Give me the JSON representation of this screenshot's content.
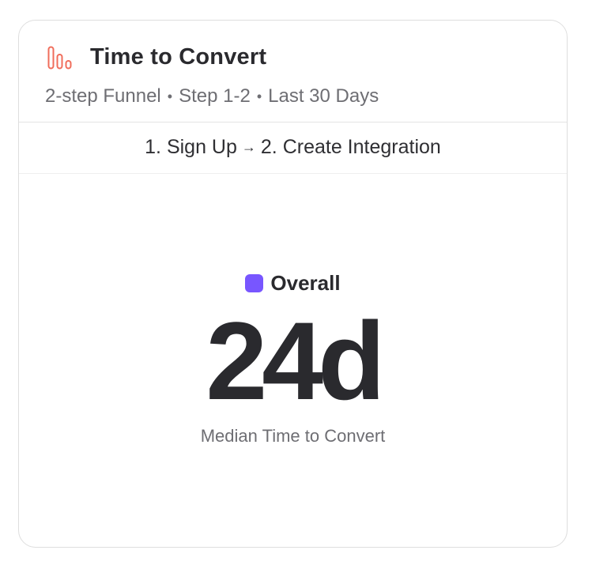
{
  "card": {
    "title": "Time to Convert",
    "icon": "bar-chart-icon",
    "icon_color": "#f06d5b",
    "subtitle": {
      "funnel": "2-step Funnel",
      "steps": "Step 1-2",
      "range": "Last 30 Days"
    },
    "steps": {
      "from": "1. Sign Up",
      "to": "2. Create Integration"
    }
  },
  "metric": {
    "series_name": "Overall",
    "series_color": "#7856ff",
    "value": "24d",
    "caption": "Median Time to Convert"
  }
}
